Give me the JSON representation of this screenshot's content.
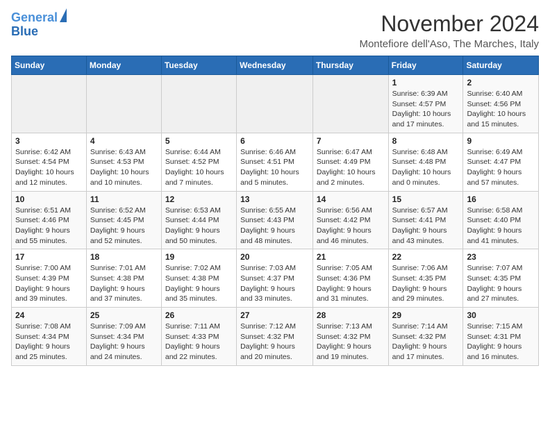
{
  "logo": {
    "line1": "General",
    "line2": "Blue"
  },
  "title": "November 2024",
  "location": "Montefiore dell'Aso, The Marches, Italy",
  "headers": [
    "Sunday",
    "Monday",
    "Tuesday",
    "Wednesday",
    "Thursday",
    "Friday",
    "Saturday"
  ],
  "weeks": [
    [
      {
        "day": "",
        "info": ""
      },
      {
        "day": "",
        "info": ""
      },
      {
        "day": "",
        "info": ""
      },
      {
        "day": "",
        "info": ""
      },
      {
        "day": "",
        "info": ""
      },
      {
        "day": "1",
        "info": "Sunrise: 6:39 AM\nSunset: 4:57 PM\nDaylight: 10 hours and 17 minutes."
      },
      {
        "day": "2",
        "info": "Sunrise: 6:40 AM\nSunset: 4:56 PM\nDaylight: 10 hours and 15 minutes."
      }
    ],
    [
      {
        "day": "3",
        "info": "Sunrise: 6:42 AM\nSunset: 4:54 PM\nDaylight: 10 hours and 12 minutes."
      },
      {
        "day": "4",
        "info": "Sunrise: 6:43 AM\nSunset: 4:53 PM\nDaylight: 10 hours and 10 minutes."
      },
      {
        "day": "5",
        "info": "Sunrise: 6:44 AM\nSunset: 4:52 PM\nDaylight: 10 hours and 7 minutes."
      },
      {
        "day": "6",
        "info": "Sunrise: 6:46 AM\nSunset: 4:51 PM\nDaylight: 10 hours and 5 minutes."
      },
      {
        "day": "7",
        "info": "Sunrise: 6:47 AM\nSunset: 4:49 PM\nDaylight: 10 hours and 2 minutes."
      },
      {
        "day": "8",
        "info": "Sunrise: 6:48 AM\nSunset: 4:48 PM\nDaylight: 10 hours and 0 minutes."
      },
      {
        "day": "9",
        "info": "Sunrise: 6:49 AM\nSunset: 4:47 PM\nDaylight: 9 hours and 57 minutes."
      }
    ],
    [
      {
        "day": "10",
        "info": "Sunrise: 6:51 AM\nSunset: 4:46 PM\nDaylight: 9 hours and 55 minutes."
      },
      {
        "day": "11",
        "info": "Sunrise: 6:52 AM\nSunset: 4:45 PM\nDaylight: 9 hours and 52 minutes."
      },
      {
        "day": "12",
        "info": "Sunrise: 6:53 AM\nSunset: 4:44 PM\nDaylight: 9 hours and 50 minutes."
      },
      {
        "day": "13",
        "info": "Sunrise: 6:55 AM\nSunset: 4:43 PM\nDaylight: 9 hours and 48 minutes."
      },
      {
        "day": "14",
        "info": "Sunrise: 6:56 AM\nSunset: 4:42 PM\nDaylight: 9 hours and 46 minutes."
      },
      {
        "day": "15",
        "info": "Sunrise: 6:57 AM\nSunset: 4:41 PM\nDaylight: 9 hours and 43 minutes."
      },
      {
        "day": "16",
        "info": "Sunrise: 6:58 AM\nSunset: 4:40 PM\nDaylight: 9 hours and 41 minutes."
      }
    ],
    [
      {
        "day": "17",
        "info": "Sunrise: 7:00 AM\nSunset: 4:39 PM\nDaylight: 9 hours and 39 minutes."
      },
      {
        "day": "18",
        "info": "Sunrise: 7:01 AM\nSunset: 4:38 PM\nDaylight: 9 hours and 37 minutes."
      },
      {
        "day": "19",
        "info": "Sunrise: 7:02 AM\nSunset: 4:38 PM\nDaylight: 9 hours and 35 minutes."
      },
      {
        "day": "20",
        "info": "Sunrise: 7:03 AM\nSunset: 4:37 PM\nDaylight: 9 hours and 33 minutes."
      },
      {
        "day": "21",
        "info": "Sunrise: 7:05 AM\nSunset: 4:36 PM\nDaylight: 9 hours and 31 minutes."
      },
      {
        "day": "22",
        "info": "Sunrise: 7:06 AM\nSunset: 4:35 PM\nDaylight: 9 hours and 29 minutes."
      },
      {
        "day": "23",
        "info": "Sunrise: 7:07 AM\nSunset: 4:35 PM\nDaylight: 9 hours and 27 minutes."
      }
    ],
    [
      {
        "day": "24",
        "info": "Sunrise: 7:08 AM\nSunset: 4:34 PM\nDaylight: 9 hours and 25 minutes."
      },
      {
        "day": "25",
        "info": "Sunrise: 7:09 AM\nSunset: 4:34 PM\nDaylight: 9 hours and 24 minutes."
      },
      {
        "day": "26",
        "info": "Sunrise: 7:11 AM\nSunset: 4:33 PM\nDaylight: 9 hours and 22 minutes."
      },
      {
        "day": "27",
        "info": "Sunrise: 7:12 AM\nSunset: 4:32 PM\nDaylight: 9 hours and 20 minutes."
      },
      {
        "day": "28",
        "info": "Sunrise: 7:13 AM\nSunset: 4:32 PM\nDaylight: 9 hours and 19 minutes."
      },
      {
        "day": "29",
        "info": "Sunrise: 7:14 AM\nSunset: 4:32 PM\nDaylight: 9 hours and 17 minutes."
      },
      {
        "day": "30",
        "info": "Sunrise: 7:15 AM\nSunset: 4:31 PM\nDaylight: 9 hours and 16 minutes."
      }
    ]
  ]
}
